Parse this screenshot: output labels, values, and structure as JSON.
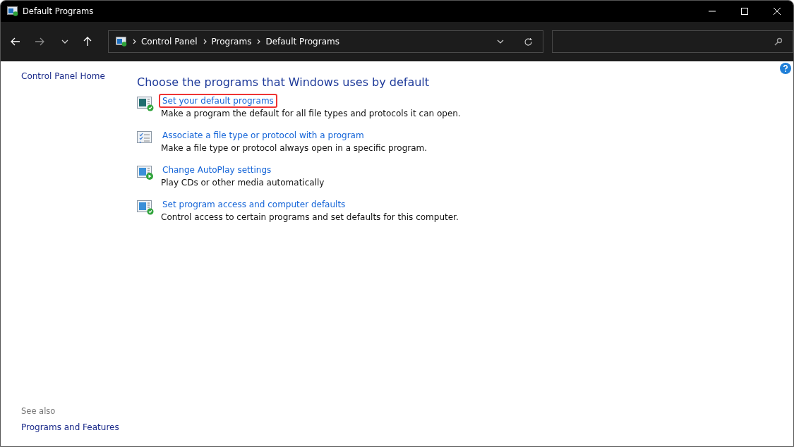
{
  "window": {
    "title": "Default Programs"
  },
  "address_bar": {
    "breadcrumbs": [
      "Control Panel",
      "Programs",
      "Default Programs"
    ]
  },
  "sidebar": {
    "home_link": "Control Panel Home",
    "see_also_label": "See also",
    "see_also_links": [
      "Programs and Features"
    ]
  },
  "heading": "Choose the programs that Windows uses by default",
  "tasks": [
    {
      "kind": "default",
      "link": "Set your default programs",
      "description": "Make a program the default for all file types and protocols it can open.",
      "highlighted": true
    },
    {
      "kind": "list",
      "link": "Associate a file type or protocol with a program",
      "description": "Make a file type or protocol always open in a specific program.",
      "highlighted": false
    },
    {
      "kind": "autoplay",
      "link": "Change AutoPlay settings",
      "description": "Play CDs or other media automatically",
      "highlighted": false
    },
    {
      "kind": "access",
      "link": "Set program access and computer defaults",
      "description": "Control access to certain programs and set defaults for this computer.",
      "highlighted": false
    }
  ]
}
